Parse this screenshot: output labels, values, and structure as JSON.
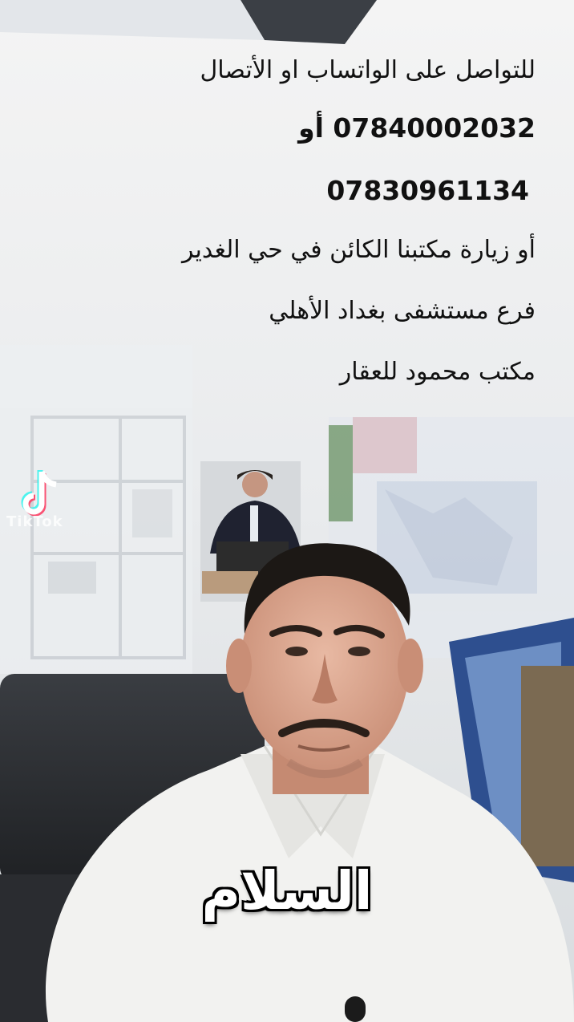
{
  "overlay": {
    "line1": "للتواصل على الواتساب او الأتصال",
    "line2": "07840002032 أو",
    "line3": "07830961134",
    "line4": "أو زيارة مكتبنا الكائن في حي الغدير",
    "line5": "فرع مستشفى بغداد الأهلي",
    "line6": "مكتب محمود للعقار"
  },
  "caption": "السلام",
  "watermark": {
    "brand": "TikTok",
    "icon": "tiktok-logo-icon"
  },
  "colors": {
    "overlay_text": "#111111",
    "caption_text": "#ffffff",
    "caption_outline": "#000000",
    "shirt": "#f2f2f0"
  }
}
